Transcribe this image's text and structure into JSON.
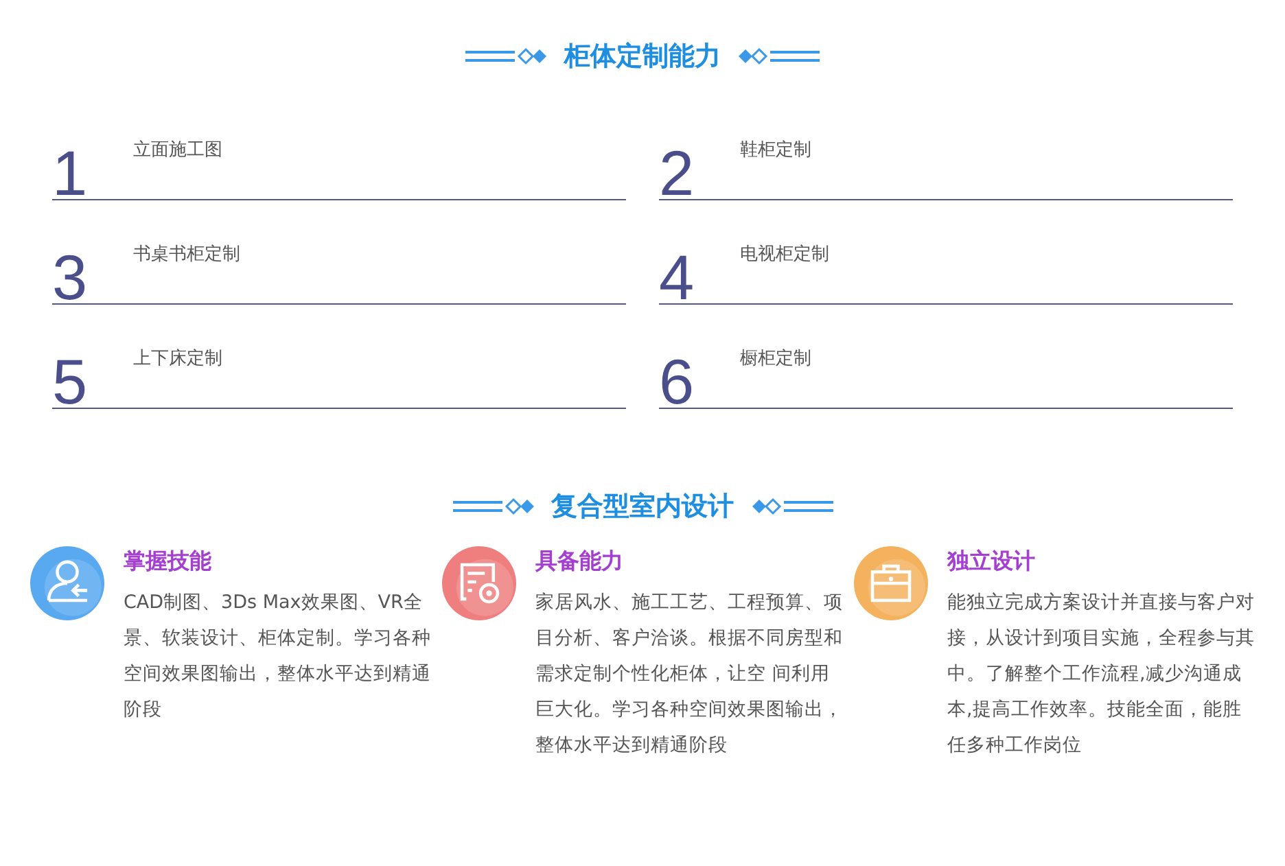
{
  "sections": [
    {
      "title": "柜体定制能力",
      "items": [
        {
          "number": "1",
          "label": "立面施工图"
        },
        {
          "number": "2",
          "label": "鞋柜定制"
        },
        {
          "number": "3",
          "label": "书桌书柜定制"
        },
        {
          "number": "4",
          "label": "电视柜定制"
        },
        {
          "number": "5",
          "label": "上下床定制"
        },
        {
          "number": "6",
          "label": "橱柜定制"
        }
      ]
    },
    {
      "title": "复合型室内设计",
      "features": [
        {
          "kind": "person",
          "color": "#59a9f0",
          "title": "掌握技能",
          "text": "CAD制图、3Ds Max效果图、VR全景、软装设计、柜体定制。学习各种空间效果图输出，整体水平达到精通阶段"
        },
        {
          "kind": "document",
          "color": "#ef7f7f",
          "title": "具备能力",
          "text": "家居风水、施工工艺、工程预算、项目分析、客户洽谈。根据不同房型和需求定制个性化柜体，让空 间利用巨大化。学习各种空间效果图输出，整体水平达到精通阶段"
        },
        {
          "kind": "briefcase",
          "color": "#f4b25e",
          "title": "独立设计",
          "text": "能独立完成方案设计并直接与客户对接，从设计到项目实施，全程参与其中。了解整个工作流程,减少沟通成本,提高工作效率。技能全面，能胜任多种工作岗位"
        }
      ]
    }
  ]
}
